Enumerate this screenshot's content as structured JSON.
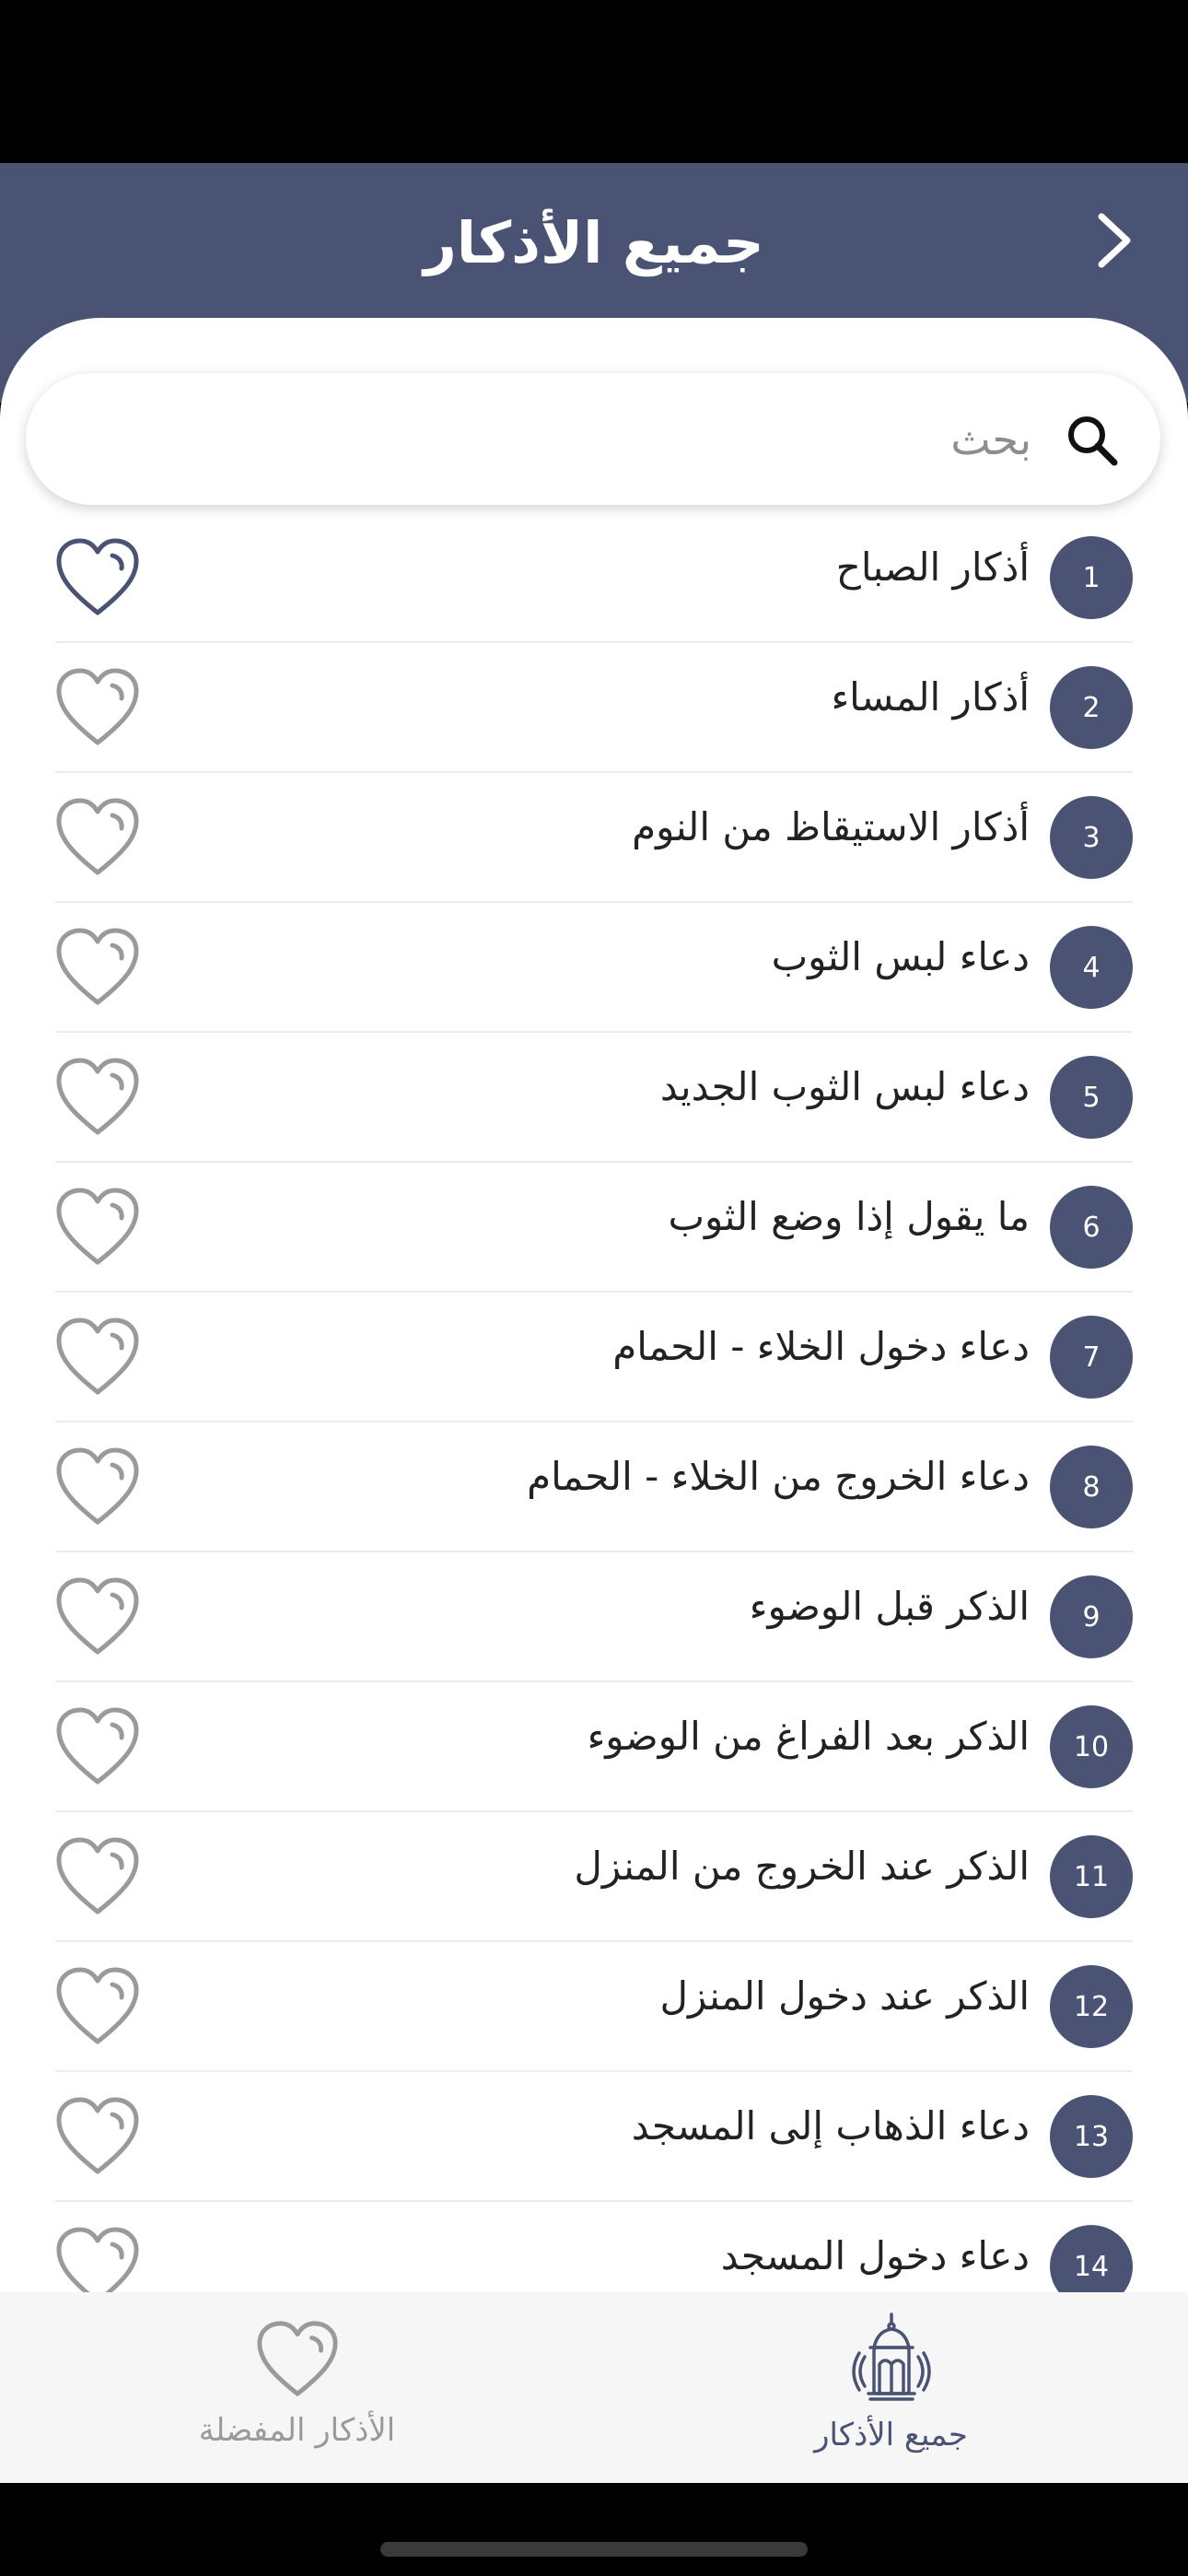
{
  "header": {
    "title": "جميع الأذكار",
    "back_icon": "chevron-right-icon"
  },
  "search": {
    "placeholder": "بحث",
    "value": "",
    "icon": "search-icon"
  },
  "list": {
    "items": [
      {
        "number": "1",
        "title": "أذكار الصباح",
        "favorite": true
      },
      {
        "number": "2",
        "title": "أذكار المساء",
        "favorite": false
      },
      {
        "number": "3",
        "title": "أذكار الاستيقاظ من النوم",
        "favorite": false
      },
      {
        "number": "4",
        "title": "دعاء لبس الثوب",
        "favorite": false
      },
      {
        "number": "5",
        "title": "دعاء لبس الثوب الجديد",
        "favorite": false
      },
      {
        "number": "6",
        "title": "ما يقول إذا وضع الثوب",
        "favorite": false
      },
      {
        "number": "7",
        "title": "دعاء دخول الخلاء - الحمام",
        "favorite": false
      },
      {
        "number": "8",
        "title": "دعاء الخروج من الخلاء - الحمام",
        "favorite": false
      },
      {
        "number": "9",
        "title": "الذكر قبل الوضوء",
        "favorite": false
      },
      {
        "number": "10",
        "title": "الذكر بعد الفراغ من الوضوء",
        "favorite": false
      },
      {
        "number": "11",
        "title": "الذكر عند الخروج من المنزل",
        "favorite": false
      },
      {
        "number": "12",
        "title": "الذكر عند دخول المنزل",
        "favorite": false
      },
      {
        "number": "13",
        "title": "دعاء الذهاب إلى المسجد",
        "favorite": false
      },
      {
        "number": "14",
        "title": "دعاء دخول المسجد",
        "favorite": false
      }
    ]
  },
  "tabbar": {
    "all": {
      "label": "جميع الأذكار",
      "icon": "lantern-icon",
      "active": true
    },
    "favorites": {
      "label": "الأذكار المفضلة",
      "icon": "heart-icon",
      "active": false
    }
  },
  "colors": {
    "primary": "#4a5373",
    "heart_active": "#4a5373",
    "heart_inactive": "#9a9a9a",
    "tab_inactive": "#9a9a9a"
  }
}
